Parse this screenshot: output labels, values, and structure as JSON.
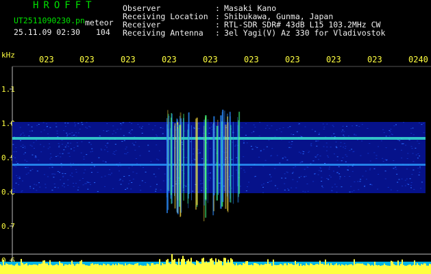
{
  "header": {
    "app_title": "HROFFT",
    "filename": "UT2511090230.pn",
    "type_label": "meteor",
    "datetime": "25.11.09 02:30",
    "count": "104"
  },
  "info": [
    {
      "label": "Observer",
      "sep": ":",
      "value": "Masaki Kano"
    },
    {
      "label": "Receiving Location",
      "sep": ":",
      "value": "Shibukawa, Gunma, Japan"
    },
    {
      "label": "Receiver",
      "sep": ":",
      "value": "RTL-SDR SDR# 43dB L15 103.2MHz CW"
    },
    {
      "label": "Receiving Antenna",
      "sep": ":",
      "value": "3el Yagi(V) Az 330 for Vladivostok"
    }
  ],
  "axis": {
    "y_unit": "kHz",
    "y_labels": [
      "1.1",
      "1.0",
      "0.9",
      "0.8",
      "0.7",
      "0.6"
    ],
    "x_labels": [
      "023",
      "023",
      "023",
      "023",
      "023",
      "023",
      "023",
      "023",
      "023",
      "0240"
    ]
  },
  "colors": {
    "background": "#000000",
    "header_title": "#00e000",
    "axis_text": "#ffff40",
    "band": "#0a1eaa",
    "band_bright": "#2a7cff",
    "carrier": "#39e0d0",
    "bottom_bar": "#00b4e6",
    "bottom_spikes": "#ffff40"
  }
}
